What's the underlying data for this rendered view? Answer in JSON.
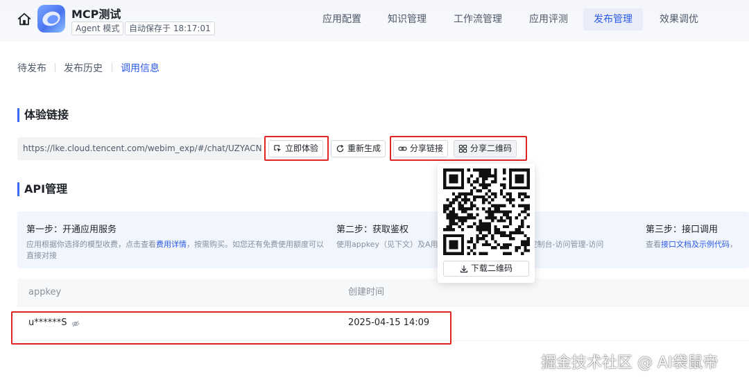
{
  "header": {
    "app_title": "MCP测试",
    "mode_badge": "Agent 模式",
    "autosave": "自动保存于 18:17:01",
    "tabs": [
      {
        "label": "应用配置",
        "active": false
      },
      {
        "label": "知识管理",
        "active": false
      },
      {
        "label": "工作流管理",
        "active": false
      },
      {
        "label": "应用评测",
        "active": false
      },
      {
        "label": "发布管理",
        "active": true
      },
      {
        "label": "效果调优",
        "active": false
      }
    ]
  },
  "sub_tabs": [
    {
      "label": "待发布",
      "active": false
    },
    {
      "label": "发布历史",
      "active": false
    },
    {
      "label": "调用信息",
      "active": true
    }
  ],
  "experience": {
    "title": "体验链接",
    "url": "https://lke.cloud.tencent.com/webim_exp/#/chat/UZYACN",
    "try_now": "立即体验",
    "regenerate": "重新生成",
    "share_link": "分享链接",
    "share_qr": "分享二维码"
  },
  "qr_popover": {
    "download": "下载二维码"
  },
  "api": {
    "title": "API管理",
    "steps": [
      {
        "title": "第一步：开通应用服务",
        "desc_before": "应用根据你选择的模型收费，点击查看",
        "desc_link": "费用详情",
        "desc_after": "，按需购买。如您还有免费使用额度可以直接对接"
      },
      {
        "title": "第二步：获取鉴权",
        "desc_before": "使用appkey（见下文）及A",
        "desc_link": "",
        "desc_after": "用获取方式，点击查看腾讯云控制台-访问管理-访问"
      },
      {
        "title": "第三步：接口调用",
        "desc_before": "查看",
        "desc_link": "接口文档及示例代码",
        "desc_after": "，"
      }
    ],
    "table": {
      "columns": [
        "appkey",
        "创建时间"
      ],
      "rows": [
        {
          "appkey": "u******S",
          "created": "2025-04-15 14:09"
        }
      ]
    }
  },
  "watermark": "掘金技术社区 @ AI袋鼠帝",
  "colors": {
    "accent": "#2b59e6",
    "highlight_box": "#e02424",
    "active_tab_bg": "#e8edf8"
  }
}
